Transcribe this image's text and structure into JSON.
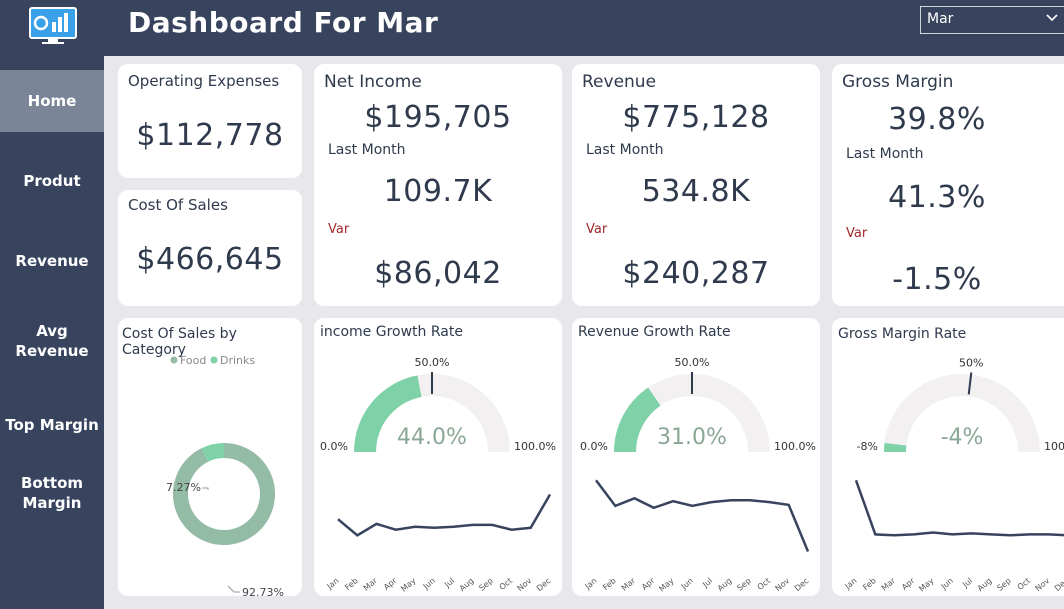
{
  "header": {
    "title": "Dashboard For Mar",
    "month_selected": "Mar"
  },
  "sidebar": {
    "items": [
      {
        "label": "Home"
      },
      {
        "label": "Produt"
      },
      {
        "label": "Revenue"
      },
      {
        "label": "Avg Revenue"
      },
      {
        "label": "Top Margin"
      },
      {
        "label": "Bottom Margin"
      }
    ]
  },
  "kpis": {
    "operating_expenses": {
      "label": "Operating Expenses",
      "value": "$112,778"
    },
    "cost_of_sales": {
      "label": "Cost Of Sales",
      "value": "$466,645"
    },
    "net_income": {
      "label": "Net Income",
      "value": "$195,705",
      "last_month_label": "Last Month",
      "last_month": "109.7K",
      "var_label": "Var",
      "var": "$86,042"
    },
    "revenue": {
      "label": "Revenue",
      "value": "$775,128",
      "last_month_label": "Last Month",
      "last_month": "534.8K",
      "var_label": "Var",
      "var": "$240,287"
    },
    "gross_margin": {
      "label": "Gross Margin",
      "value": "39.8%",
      "last_month_label": "Last Month",
      "last_month": "41.3%",
      "var_label": "Var",
      "var": "-1.5%"
    }
  },
  "colors": {
    "accent": "#7fd1a8",
    "donut": "#93bba5",
    "line": "#38445e",
    "nav_bg": "#38445e",
    "gauge_track": "#f3f0f2"
  },
  "chart_data": [
    {
      "type": "pie",
      "title": "Cost Of Sales by Category",
      "legend": [
        "Food",
        "Drinks"
      ],
      "categories": [
        "Food",
        "Drinks"
      ],
      "values": [
        92.73,
        7.27
      ],
      "data_labels": [
        "92.73%",
        "7.27%"
      ],
      "colors": [
        "#93bba5",
        "#7fd1a8"
      ]
    },
    {
      "type": "gauge",
      "title": "income Growth Rate",
      "value": 44.0,
      "value_label": "44.0%",
      "min_label": "0.0%",
      "max_label": "100.0%",
      "target_label": "50.0%",
      "min": 0,
      "max": 100,
      "target": 50
    },
    {
      "type": "gauge",
      "title": "Revenue Growth Rate",
      "value": 31.0,
      "value_label": "31.0%",
      "min_label": "0.0%",
      "max_label": "100.0%",
      "target_label": "50.0%",
      "min": 0,
      "max": 100,
      "target": 50
    },
    {
      "type": "gauge",
      "title": "Gross Margin Rate",
      "value": -4,
      "value_label": "-4%",
      "min_label": "-8%",
      "max_label": "100%",
      "target_label": "50%",
      "min": -8,
      "max": 100,
      "target": 50
    },
    {
      "type": "line",
      "x": [
        "Jan",
        "Feb",
        "Mar",
        "Apr",
        "May",
        "Jun",
        "Jul",
        "Aug",
        "Sep",
        "Oct",
        "Nov",
        "Dec"
      ],
      "values": [
        0.44,
        0.27,
        0.39,
        0.33,
        0.36,
        0.35,
        0.36,
        0.38,
        0.38,
        0.33,
        0.35,
        0.7
      ]
    },
    {
      "type": "line",
      "x": [
        "Jan",
        "Feb",
        "Mar",
        "Apr",
        "May",
        "Jun",
        "Jul",
        "Aug",
        "Sep",
        "Oct",
        "Nov",
        "Dec"
      ],
      "values": [
        0.85,
        0.58,
        0.66,
        0.56,
        0.63,
        0.58,
        0.62,
        0.64,
        0.64,
        0.62,
        0.59,
        0.1
      ]
    },
    {
      "type": "line",
      "x": [
        "Jan",
        "Feb",
        "Mar",
        "Apr",
        "May",
        "Jun",
        "Jul",
        "Aug",
        "Sep",
        "Oct",
        "Nov",
        "Dec"
      ],
      "values": [
        0.85,
        0.28,
        0.27,
        0.28,
        0.3,
        0.28,
        0.29,
        0.28,
        0.27,
        0.28,
        0.28,
        0.27
      ]
    }
  ]
}
